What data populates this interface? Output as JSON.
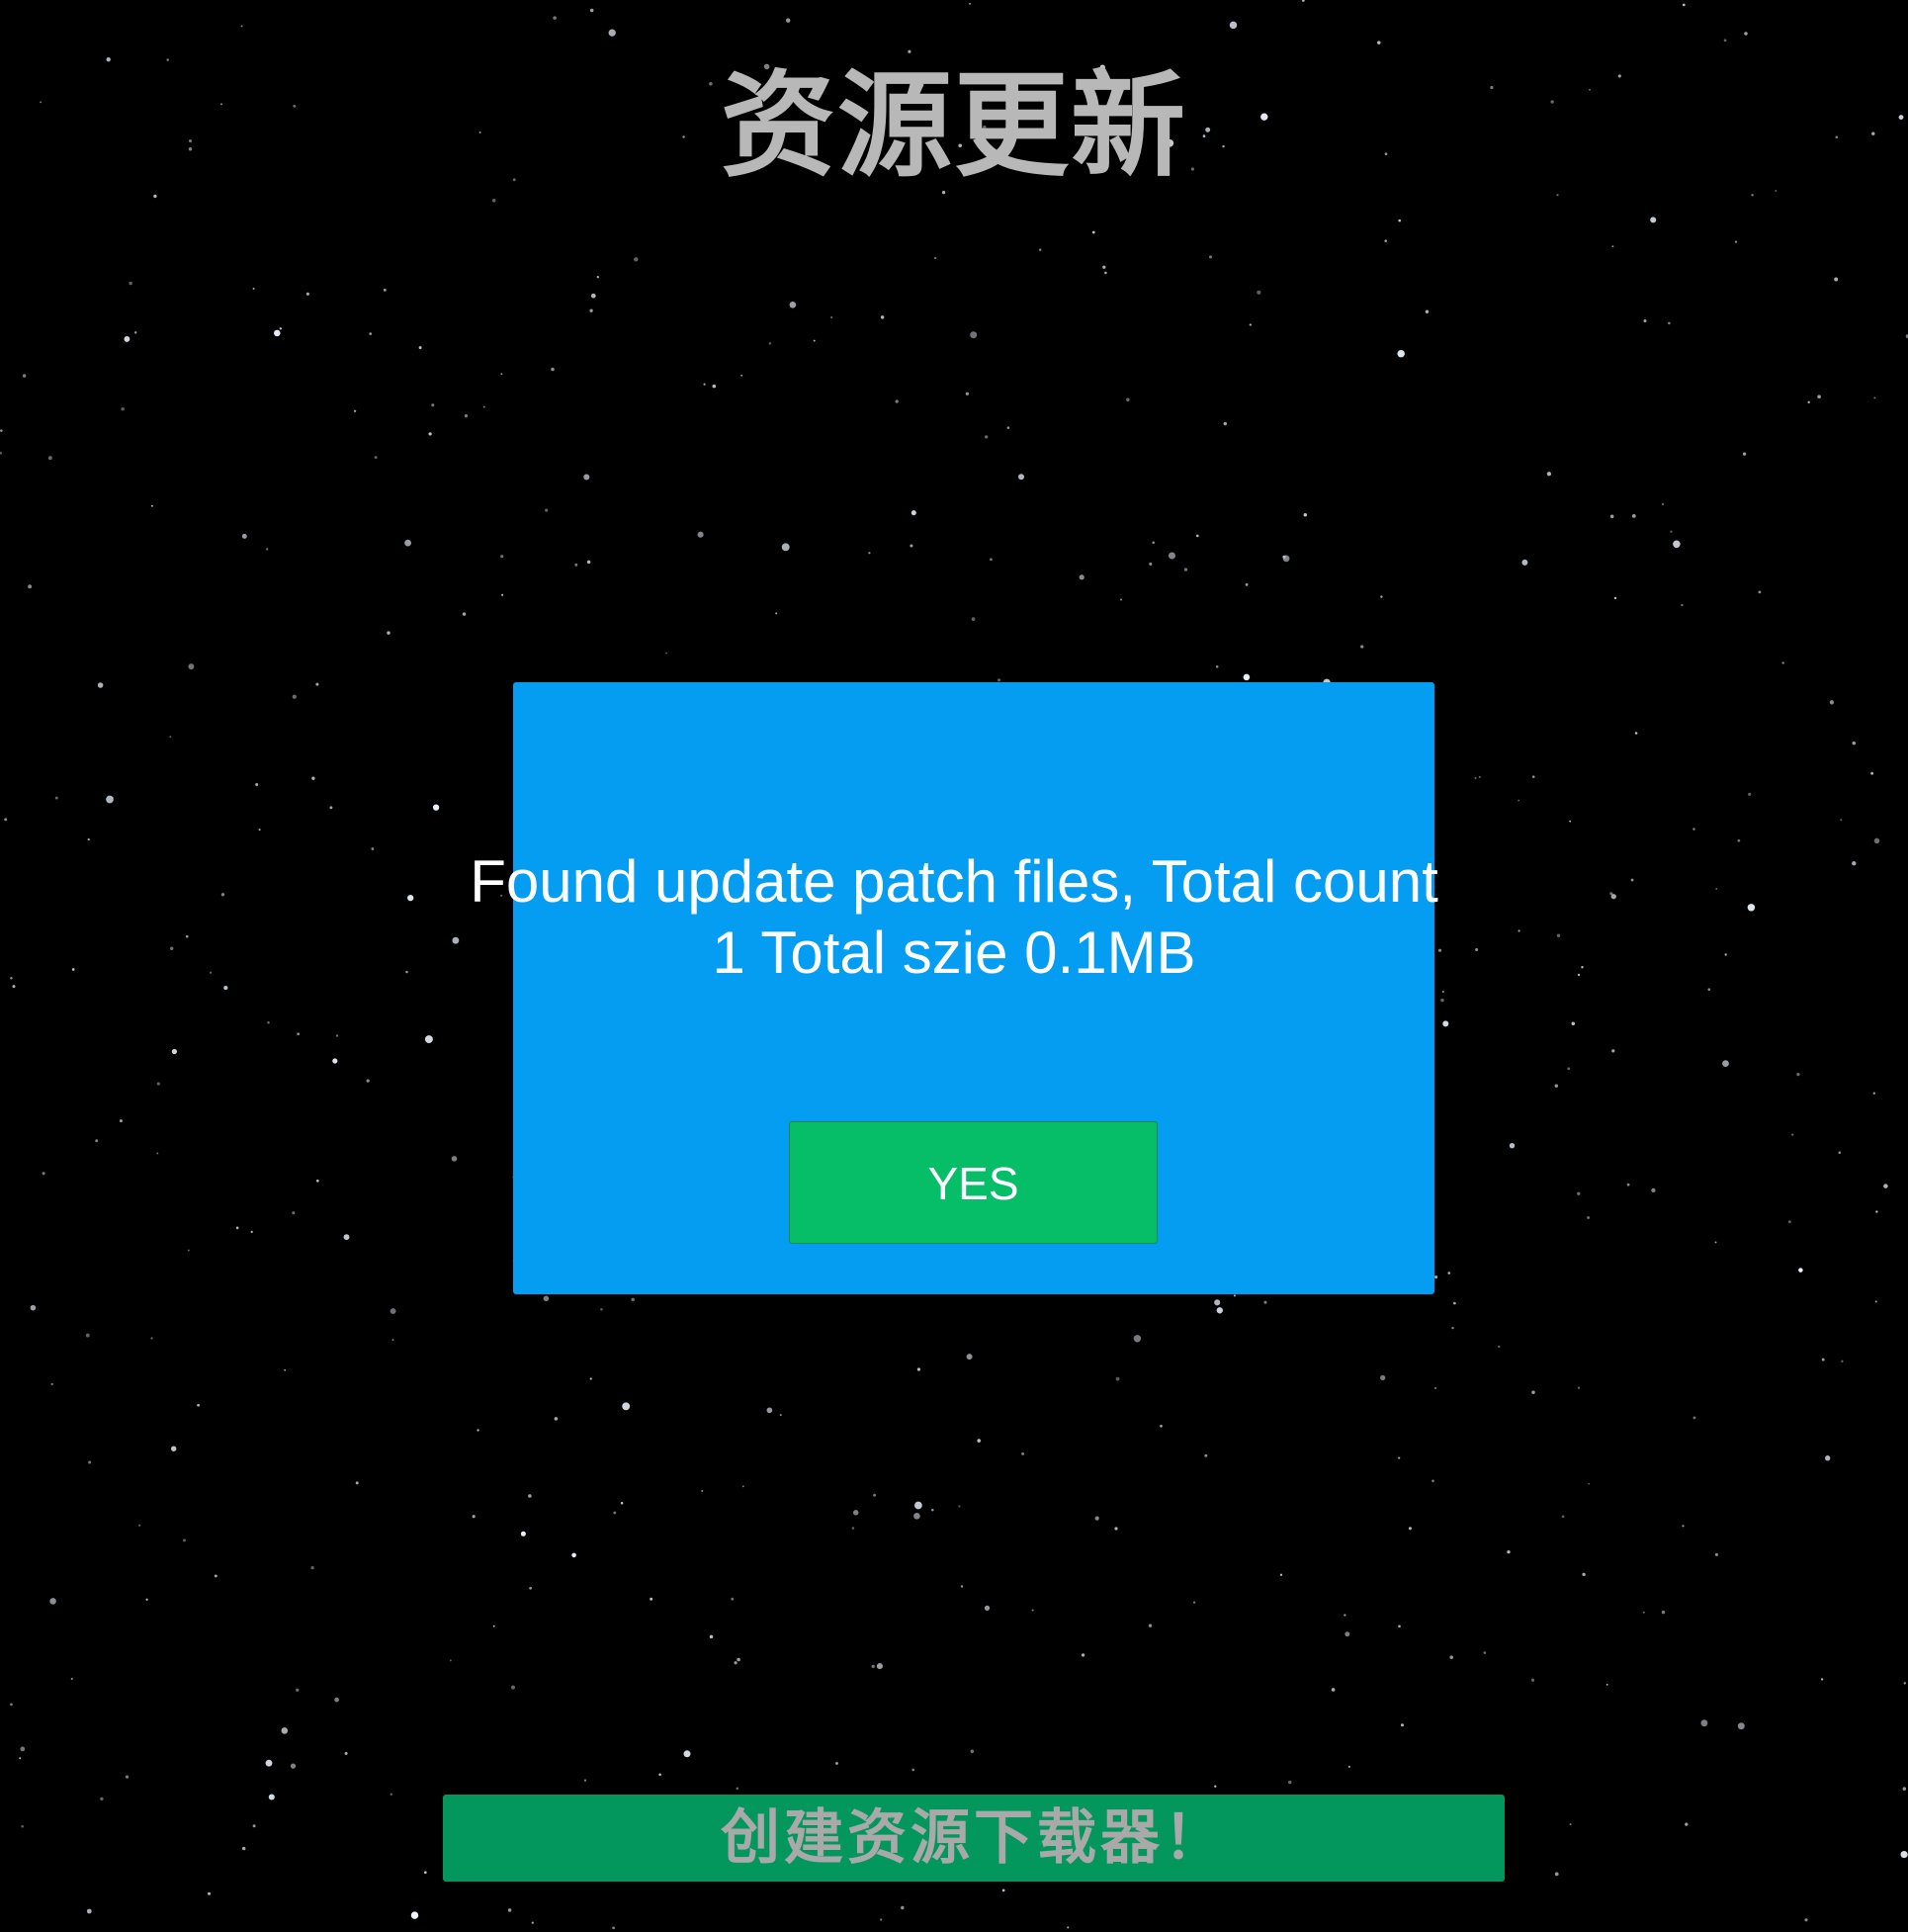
{
  "title": "资源更新",
  "dialog": {
    "message_line1": "Found update patch files, Total count",
    "message_line2": "1 Total szie 0.1MB",
    "yes_label": "YES"
  },
  "bottom_button": {
    "label": "创建资源下载器！"
  },
  "colors": {
    "background": "#000000",
    "dialog": "#049df2",
    "yes_button": "#06bd68",
    "bottom_button": "#03975e",
    "title_text": "#b8b8b8",
    "bottom_button_text": "#a9a9a9"
  }
}
